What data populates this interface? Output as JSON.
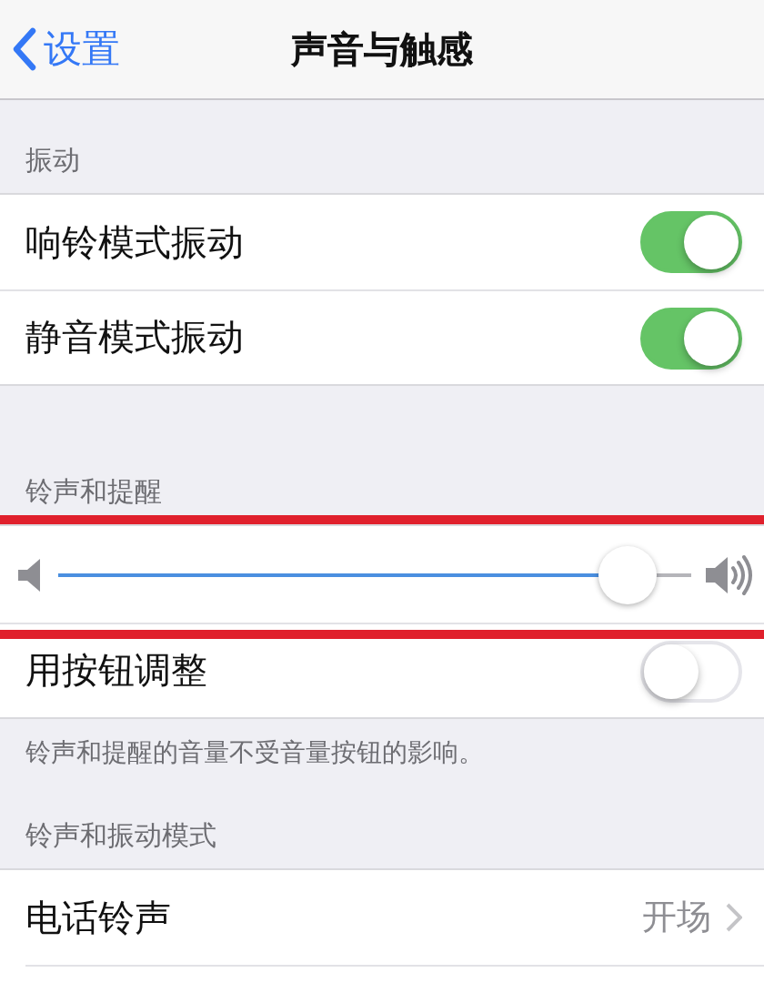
{
  "nav": {
    "back_label": "设置",
    "title": "声音与触感"
  },
  "sections": [
    {
      "header": "振动",
      "rows": [
        {
          "kind": "toggle",
          "label": "响铃模式振动",
          "on": true
        },
        {
          "kind": "toggle",
          "label": "静音模式振动",
          "on": true
        }
      ]
    },
    {
      "header": "铃声和提醒",
      "rows": [
        {
          "kind": "slider",
          "level": 0.94,
          "highlighted": true
        },
        {
          "kind": "toggle",
          "label": "用按钮调整",
          "on": false
        }
      ],
      "footer": "铃声和提醒的音量不受音量按钮的影响。"
    },
    {
      "header": "铃声和振动模式",
      "rows": [
        {
          "kind": "disclosure",
          "label": "电话铃声",
          "value": "开场"
        }
      ]
    }
  ]
}
